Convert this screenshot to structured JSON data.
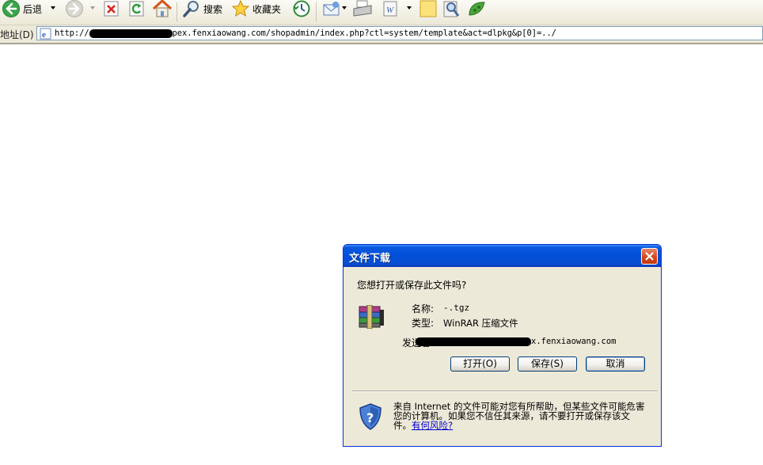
{
  "toolbar": {
    "back_label": "后退",
    "search_label": "搜索",
    "favorites_label": "收藏夹"
  },
  "address_bar": {
    "label": "地址(D)",
    "url_prefix": "http://",
    "url_suffix": "pex.fenxiaowang.com/shopadmin/index.php?ctl=system/template&act=dlpkg&p[0]=../"
  },
  "dialog": {
    "title": "文件下载",
    "question": "您想打开或保存此文件吗?",
    "name_label": "名称:",
    "name_value": "-.tgz",
    "type_label": "类型:",
    "type_value": "WinRAR 压缩文件",
    "from_label": "发送者",
    "from_value_suffix": "x.fenxiaowang.com",
    "buttons": {
      "open": "打开(O)",
      "save": "保存(S)",
      "cancel": "取消"
    },
    "warning_text": "来自 Internet 的文件可能对您有所帮助，但某些文件可能危害您的计算机。如果您不信任其来源，请不要打开或保存该文件。",
    "risk_link": "有何风险?"
  }
}
